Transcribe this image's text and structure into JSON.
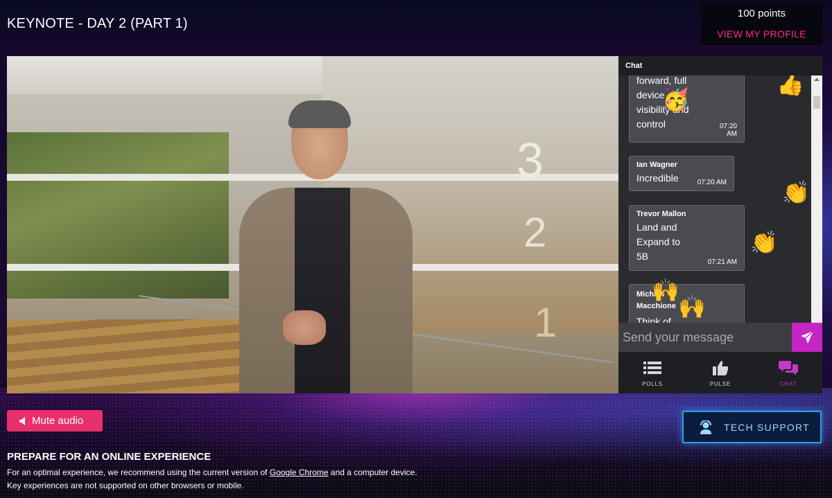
{
  "page": {
    "title": "KEYNOTE - DAY 2 (PART 1)"
  },
  "profile": {
    "points": "100 points",
    "view_profile": "VIEW MY PROFILE"
  },
  "video": {
    "room_numbers": [
      "3",
      "2",
      "1"
    ]
  },
  "chat": {
    "header": "Chat",
    "messages": [
      {
        "author": "",
        "lines": [
          "forward, full",
          "device",
          "visibility and",
          "control"
        ],
        "time": [
          "07:20",
          "AM"
        ]
      },
      {
        "author": "Ian Wagner",
        "lines": [
          "Incredible"
        ],
        "time": [
          "07:20 AM"
        ]
      },
      {
        "author": "Trevor Mallon",
        "lines": [
          "Land and",
          "Expand to",
          "5B"
        ],
        "time": [
          "07:21 AM"
        ]
      },
      {
        "author": "Michael Macchione",
        "lines": [
          "Think of"
        ],
        "time": []
      }
    ],
    "input_placeholder": "Send your message",
    "tabs": [
      {
        "label": "POLLS",
        "icon": "list-icon"
      },
      {
        "label": "PULSE",
        "icon": "thumbs-up-icon"
      },
      {
        "label": "CHAT",
        "icon": "chat-bubbles-icon"
      }
    ],
    "reactions": [
      "thumbs-up",
      "partying-face",
      "clapping-hands",
      "clapping-hands",
      "raising-hands",
      "raising-hands"
    ]
  },
  "controls": {
    "mute_label": "Mute audio",
    "tech_support_label": "TECH SUPPORT"
  },
  "info": {
    "heading": "PREPARE FOR AN ONLINE EXPERIENCE",
    "line1_before": "For an optimal experience, we recommend using the current version of ",
    "line1_link": "Google Chrome",
    "line1_after": " and a computer device.",
    "line2": "Key experiences are not supported on other browsers or mobile."
  },
  "colors": {
    "accent_pink": "#e8306c",
    "accent_magenta": "#c326c4",
    "tech_blue": "#2fa0e8",
    "profile_link": "#ff2a8a"
  }
}
